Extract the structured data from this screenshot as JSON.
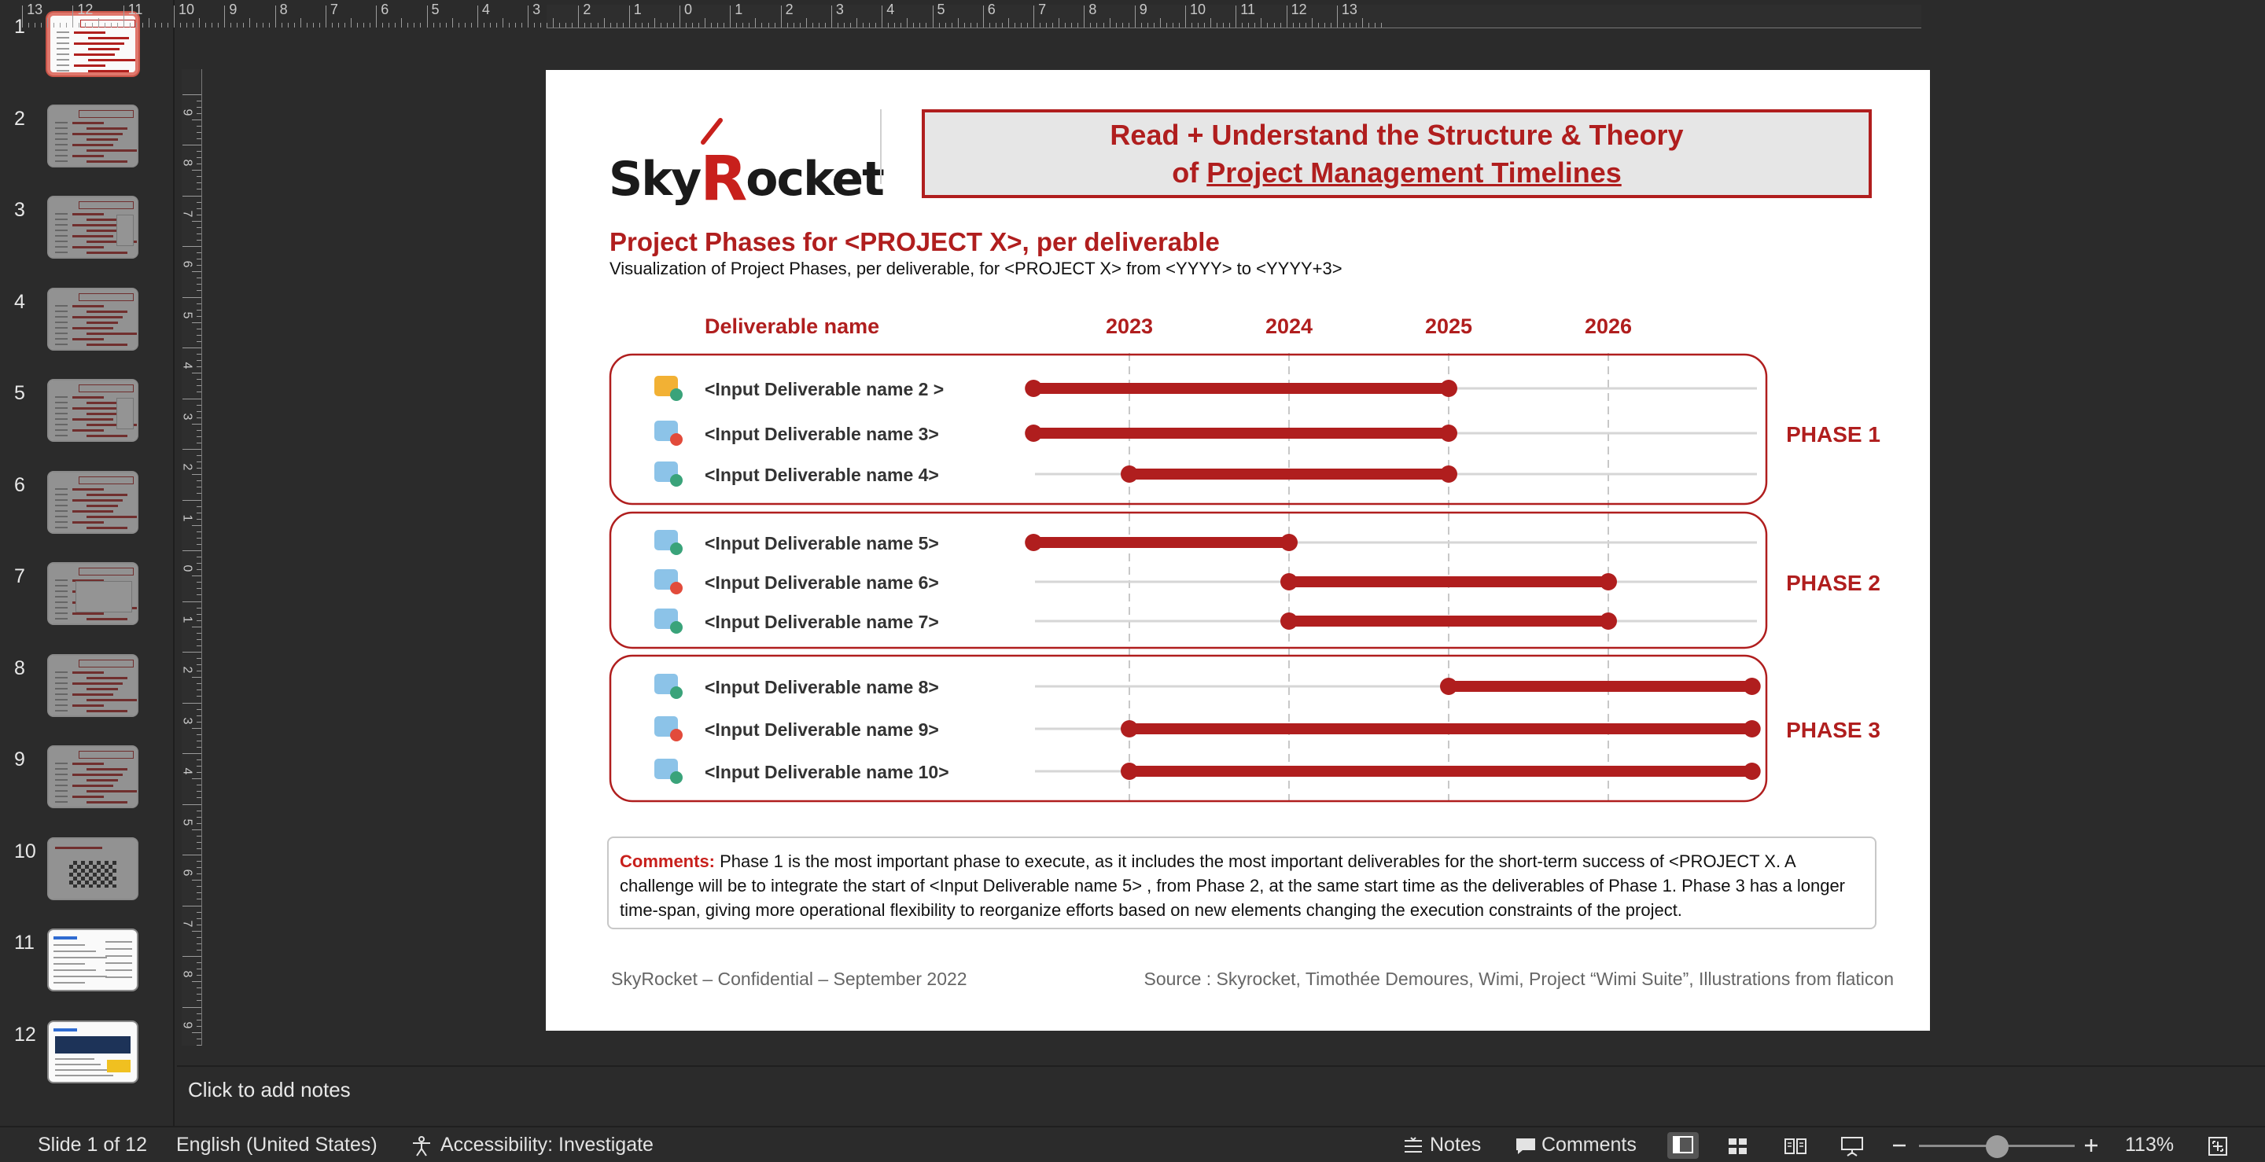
{
  "thumbnails": [
    {
      "num": "1",
      "active": true,
      "kind": "timeline"
    },
    {
      "num": "2",
      "active": false,
      "kind": "table"
    },
    {
      "num": "3",
      "active": false,
      "kind": "table-side"
    },
    {
      "num": "4",
      "active": false,
      "kind": "table"
    },
    {
      "num": "5",
      "active": false,
      "kind": "table-side"
    },
    {
      "num": "6",
      "active": false,
      "kind": "bright"
    },
    {
      "num": "7",
      "active": false,
      "kind": "table-box"
    },
    {
      "num": "8",
      "active": false,
      "kind": "table"
    },
    {
      "num": "9",
      "active": false,
      "kind": "table"
    },
    {
      "num": "10",
      "active": false,
      "kind": "flags"
    },
    {
      "num": "11",
      "active": false,
      "kind": "doc"
    },
    {
      "num": "12",
      "active": false,
      "kind": "photo"
    }
  ],
  "ruler": {
    "horizontal": [
      "13",
      "12",
      "11",
      "10",
      "9",
      "8",
      "7",
      "6",
      "5",
      "4",
      "3",
      "2",
      "1",
      "0",
      "1",
      "2",
      "3",
      "4",
      "5",
      "6",
      "7",
      "8",
      "9",
      "10",
      "11",
      "12",
      "13"
    ],
    "vertical": [
      "9",
      "8",
      "7",
      "6",
      "5",
      "4",
      "3",
      "2",
      "1",
      "0",
      "1",
      "2",
      "3",
      "4",
      "5",
      "6",
      "7",
      "8",
      "9"
    ]
  },
  "slide": {
    "logo": {
      "pre": "Sky",
      "r": "R",
      "post": "ocket"
    },
    "banner": {
      "line1": "Read + Understand the Structure & Theory",
      "line2_prefix": "of ",
      "line2_underlined": "Project Management Timelines"
    },
    "title": "Project Phases for <PROJECT X>, per deliverable",
    "subtitle": "Visualization of Project Phases, per deliverable, for <PROJECT X> from <YYYY> to <YYYY+3>",
    "comments_label": "Comments:",
    "comments_text": " Phase 1 is the most important phase to execute, as it includes the most important deliverables for the short-term success of <PROJECT X. A challenge will be to integrate the start of <Input Deliverable name 5> , from Phase 2, at the same start time as the deliverables of Phase 1. Phase 3 has a longer time-span, giving more operational flexibility to reorganize efforts based on new elements changing the execution constraints of the project.",
    "footer_left": "SkyRocket – Confidential – September 2022",
    "footer_right": "Source : Skyrocket, Timothée Demoures, Wimi, Project “Wimi Suite”, Illustrations from flaticon",
    "colors": {
      "accent": "#b01e1e",
      "grid": "#d6d6d6",
      "dashed": "#c8c8c8"
    }
  },
  "chart_data": {
    "type": "timeline",
    "column_header": "Deliverable name",
    "years": [
      "2023",
      "2024",
      "2025",
      "2026"
    ],
    "phases": [
      {
        "name": "PHASE 1",
        "rows": [
          {
            "label": "<Input Deliverable name 2 >",
            "icon": "mail-shield-icon",
            "start": 2022.4,
            "end": 2025.0
          },
          {
            "label": "<Input Deliverable name 3>",
            "icon": "chart-gear-icon",
            "start": 2022.4,
            "end": 2025.0
          },
          {
            "label": "<Input Deliverable name 4>",
            "icon": "shield-lock-icon",
            "start": 2023.0,
            "end": 2025.0
          }
        ]
      },
      {
        "name": "PHASE 2",
        "rows": [
          {
            "label": "<Input Deliverable name 5>",
            "icon": "document-pen-icon",
            "start": 2022.4,
            "end": 2024.0
          },
          {
            "label": "<Input Deliverable name 6>",
            "icon": "lock-shield-icon",
            "start": 2024.0,
            "end": 2026.0
          },
          {
            "label": "<Input Deliverable name 7>",
            "icon": "settings-list-icon",
            "start": 2024.0,
            "end": 2026.0
          }
        ]
      },
      {
        "name": "PHASE 3",
        "rows": [
          {
            "label": "<Input Deliverable name 8>",
            "icon": "brain-shield-icon",
            "start": 2025.0,
            "end": 2026.9
          },
          {
            "label": "<Input Deliverable name 9>",
            "icon": "document-gear-icon",
            "start": 2023.0,
            "end": 2026.9
          },
          {
            "label": "<Input Deliverable name 10>",
            "icon": "team-cycle-icon",
            "start": 2023.0,
            "end": 2026.9
          }
        ]
      }
    ]
  },
  "notes": {
    "placeholder": "Click to add notes"
  },
  "statusbar": {
    "slide_info": "Slide 1 of 12",
    "language": "English (United States)",
    "accessibility": "Accessibility: Investigate",
    "notes_label": "Notes",
    "comments_label": "Comments",
    "zoom": "113%"
  }
}
